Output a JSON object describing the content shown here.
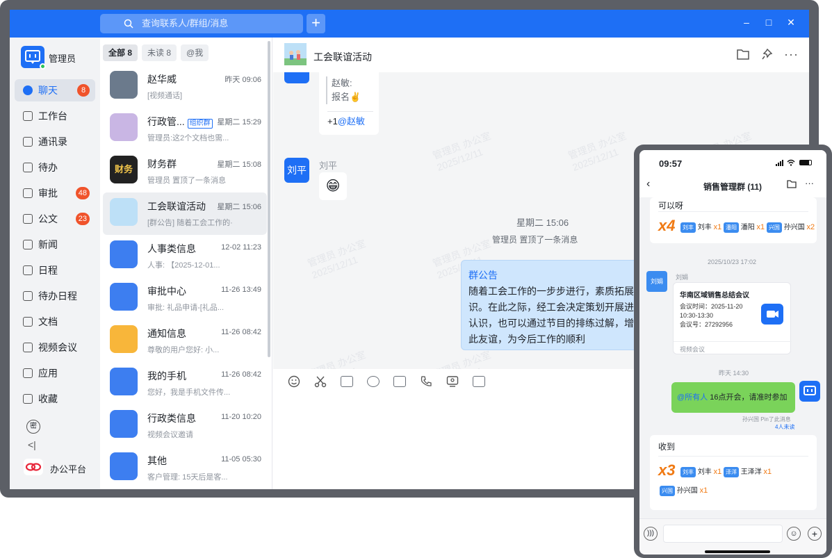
{
  "search": {
    "placeholder": "查询联系人/群组/消息"
  },
  "user": {
    "name": "管理员"
  },
  "nav": [
    {
      "label": "聊天",
      "badge": "8",
      "active": true
    },
    {
      "label": "工作台"
    },
    {
      "label": "通讯录"
    },
    {
      "label": "待办"
    },
    {
      "label": "审批",
      "badge": "48"
    },
    {
      "label": "公文",
      "badge": "23"
    },
    {
      "label": "新闻"
    },
    {
      "label": "日程"
    },
    {
      "label": "待办日程"
    },
    {
      "label": "文档"
    },
    {
      "label": "视频会议"
    },
    {
      "label": "应用"
    },
    {
      "label": "收藏"
    }
  ],
  "sidebar_bottom": {
    "secret_label": "密",
    "collapse": "<|",
    "platform": "办公平台"
  },
  "filters": [
    "全部 8",
    "未读 8",
    "@我"
  ],
  "conversations": [
    {
      "name": "赵华威",
      "time": "昨天 09:06",
      "msg": "[视频通话]",
      "color": "#6b7a8c"
    },
    {
      "name": "行政管...",
      "tag": "组织群",
      "time": "星期二 15:29",
      "msg": "管理员:这2个文档也需...",
      "color": "#c9b6e4"
    },
    {
      "name": "财务群",
      "time": "星期二 15:08",
      "msg": "管理员 置顶了一条消息",
      "color": "#222",
      "avtext": "财务"
    },
    {
      "name": "工会联谊活动",
      "time": "星期二 15:06",
      "msg": "[群公告] 随着工会工作的·",
      "color": "#bde0f7",
      "selected": true
    },
    {
      "name": "人事类信息",
      "time": "12-02 11:23",
      "msg": "人事: 【2025-12-01...",
      "color": "#3d7ef0"
    },
    {
      "name": "审批中心",
      "time": "11-26 13:49",
      "msg": "审批: 礼品申请-[礼品...",
      "color": "#3d7ef0"
    },
    {
      "name": "通知信息",
      "time": "11-26 08:42",
      "msg": "尊敬的用户您好: 小...",
      "color": "#f8b63a"
    },
    {
      "name": "我的手机",
      "time": "11-26 08:42",
      "msg": "您好，我是手机文件传...",
      "color": "#3d7ef0"
    },
    {
      "name": "行政类信息",
      "time": "11-20 10:20",
      "msg": "视频会议邀请",
      "color": "#3d7ef0"
    },
    {
      "name": "其他",
      "time": "11-05 05:30",
      "msg": "客户管理: 15天后是客...",
      "color": "#3d7ef0"
    }
  ],
  "chat": {
    "title": "工会联谊活动",
    "reply_quote_name": "赵敏:",
    "reply_quote_text": "报名✌️",
    "reply_plus": "+1",
    "reply_mention": "@赵敏",
    "sender1_box": "刘平",
    "sender1_name": "刘平",
    "sender1_emoji": "😁",
    "time_divider": "星期二 15:06",
    "pin_notice": "管理员 置顶了一条消息",
    "notice_title": "群公告",
    "notice_text": "随着工会工作的一步步进行，素质拓展认识。在此之际，经工会决定策划开展进一步认识，也可以通过节目的排练过解，增进彼此友谊，为今后工作的顺利",
    "watermark": "管理员 办公室",
    "watermark_date": "2025/12/11"
  },
  "phone": {
    "time": "09:57",
    "title": "销售管理群 (11)",
    "card1": {
      "text": "可以呀",
      "count": "x4",
      "chips": [
        {
          "chip": "刘丰",
          "name": "刘丰",
          "n": "x1"
        },
        {
          "chip": "潘阳",
          "name": "潘阳",
          "n": "x1"
        },
        {
          "chip": "兴国",
          "name": "孙兴国",
          "n": "x2"
        }
      ]
    },
    "ts1": "2025/10/23 17:02",
    "sender": "刘娟",
    "meeting": {
      "title": "华南区域销售总结会议",
      "time_label": "会议时间：2025-11-20",
      "time_range": "10:30-13:30",
      "no": "会议号：27292956",
      "footer": "视频会议"
    },
    "ts2": "昨天 14:30",
    "mymsg_at": "@所有人",
    "mymsg": " 16点开会，请准时参加",
    "pin_info": "孙兴国 Pin了此消息",
    "unread": "4人未读",
    "card2": {
      "text": "收到",
      "count": "x3",
      "chips": [
        {
          "chip": "刘丰",
          "name": "刘丰",
          "n": "x1"
        },
        {
          "chip": "泽洋",
          "name": "王泽洋",
          "n": "x1"
        },
        {
          "chip": "兴国",
          "name": "孙兴国",
          "n": "x1"
        }
      ]
    }
  }
}
